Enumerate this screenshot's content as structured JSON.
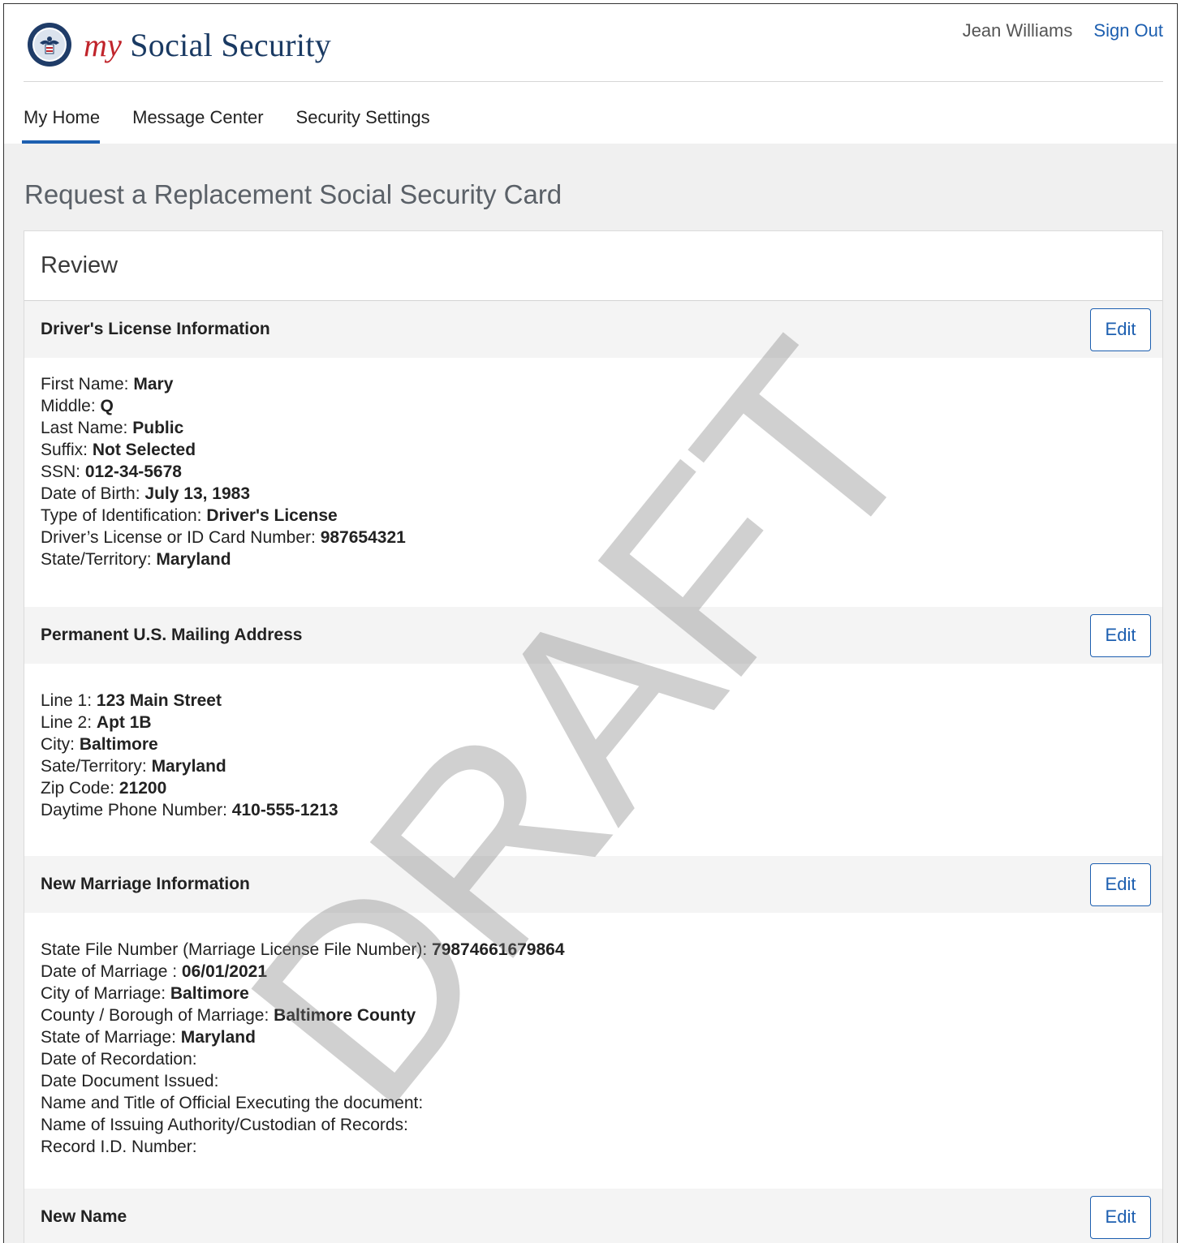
{
  "header": {
    "brand_my": "my",
    "brand_rest": "Social Security",
    "user_name": "Jean Williams",
    "sign_out": "Sign Out"
  },
  "nav": {
    "items": [
      {
        "label": "My Home",
        "active": true
      },
      {
        "label": "Message Center"
      },
      {
        "label": "Security Settings"
      }
    ]
  },
  "page": {
    "title": "Request a Replacement Social Security Card",
    "card_title": "Review",
    "edit_label": "Edit",
    "watermark": "DRAFT"
  },
  "sections": [
    {
      "title": "Driver's License Information",
      "rows": [
        {
          "label": "First Name:",
          "value": "Mary"
        },
        {
          "label": "Middle:",
          "value": "Q"
        },
        {
          "label": "Last Name:",
          "value": "Public"
        },
        {
          "label": "Suffix:",
          "value": "Not Selected"
        },
        {
          "label": "SSN:",
          "value": "012-34-5678"
        },
        {
          "label": "Date of Birth:",
          "value": "July 13, 1983"
        },
        {
          "label": "Type of Identification:",
          "value": "Driver's License"
        },
        {
          "label": "Driver’s License or ID Card Number:",
          "value": "987654321"
        },
        {
          "label": "State/Territory:",
          "value": "Maryland"
        }
      ]
    },
    {
      "title": "Permanent U.S. Mailing Address",
      "rows": [
        {
          "label": "Line 1:",
          "value": "123 Main Street"
        },
        {
          "label": "Line 2:",
          "value": "Apt 1B"
        },
        {
          "label": "City:",
          "value": "Baltimore"
        },
        {
          "label": "Sate/Territory:",
          "value": "Maryland"
        },
        {
          "label": "Zip Code:",
          "value": "21200"
        },
        {
          "label": "Daytime Phone Number:",
          "value": "410-555-1213"
        }
      ]
    },
    {
      "title": "New Marriage Information",
      "rows": [
        {
          "label": "State File Number (Marriage License File Number):",
          "value": "79874661679864"
        },
        {
          "label": "Date of Marriage :",
          "value": "06/01/2021"
        },
        {
          "label": "City of Marriage:",
          "value": "Baltimore"
        },
        {
          "label": "County / Borough of Marriage:",
          "value": "Baltimore County"
        },
        {
          "label": "State of Marriage:",
          "value": "Maryland"
        },
        {
          "label": "Date of Recordation:",
          "value": ""
        },
        {
          "label": "Date Document Issued:",
          "value": ""
        },
        {
          "label": "Name and Title of Official Executing the document:",
          "value": ""
        },
        {
          "label": "Name of Issuing Authority/Custodian of Records:",
          "value": ""
        },
        {
          "label": "Record I.D. Number:",
          "value": ""
        }
      ]
    },
    {
      "title": "New Name",
      "rows": []
    }
  ]
}
